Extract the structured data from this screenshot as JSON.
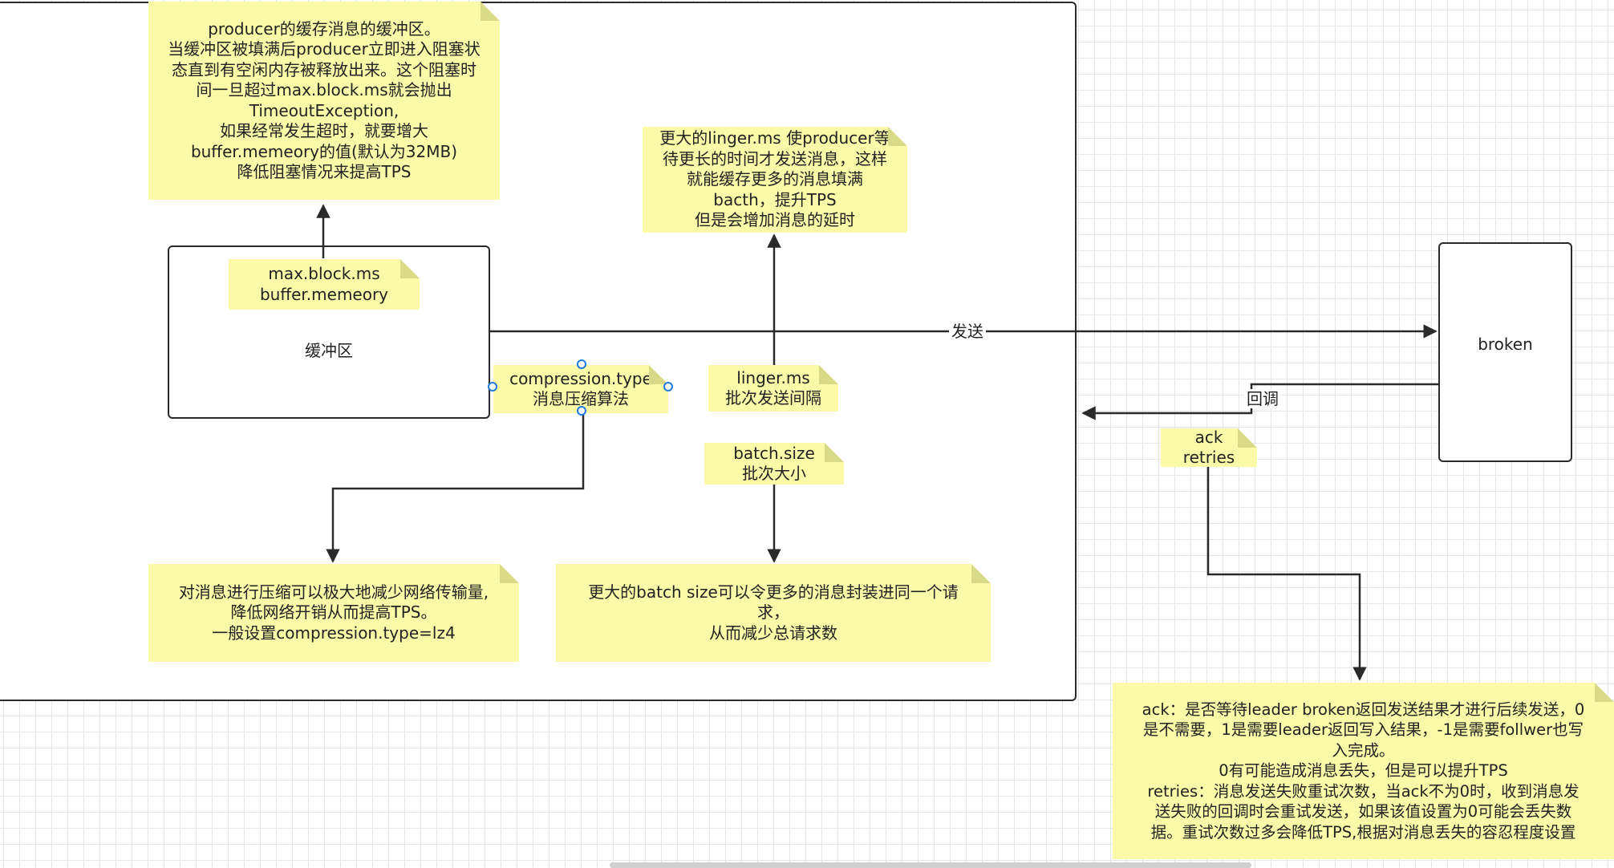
{
  "diagram": {
    "box_buffer": {
      "label": "缓冲区"
    },
    "box_broker": {
      "label": "broken"
    },
    "edge_send": {
      "label": "发送"
    },
    "edge_callback": {
      "label": "回调"
    },
    "notes": {
      "buffer_desc": "producer的缓存消息的缓冲区。\n当缓冲区被填满后producer立即进入阻塞状\n态直到有空闲内存被释放出来。这个阻塞时\n间一旦超过max.block.ms就会抛出\nTimeoutException,\n如果经常发生超时，就要增大\nbuffer.memeory的值(默认为32MB)\n降低阻塞情况来提高TPS",
      "buffer_params": "max.block.ms\nbuffer.memeory",
      "linger_desc": "更大的linger.ms 使producer等\n待更长的时间才发送消息，这样\n就能缓存更多的消息填满\nbacth，提升TPS\n但是会增加消息的延时",
      "compression_param": "compression.type\n消息压缩算法",
      "linger_param": "linger.ms\n批次发送间隔",
      "batch_param": "batch.size\n    批次大小",
      "compression_desc": "对消息进行压缩可以极大地减少网络传输量,\n降低网络开销从而提高TPS。\n一般设置compression.type=lz4",
      "batch_desc": "更大的batch size可以令更多的消息封装进同一个请\n求，\n从而减少总请求数",
      "ack_param": "ack\nretries",
      "ack_desc": "ack：是否等待leader broken返回发送结果才进行后续发送，0\n是不需要，1是需要leader返回写入结果，-1是需要follwer也写\n入完成。\n0有可能造成消息丢失，但是可以提升TPS\nretries：消息发送失败重试次数，当ack不为0时，收到消息发\n送失败的回调时会重试发送，如果该值设置为0可能会丢失数\n据。重试次数过多会降低TPS,根据对消息丢失的容忍程度设置"
    },
    "colors": {
      "note_fill": "#fafaa8",
      "stroke": "#2a2a2a",
      "selection_handle": "#1f7ae0"
    }
  }
}
